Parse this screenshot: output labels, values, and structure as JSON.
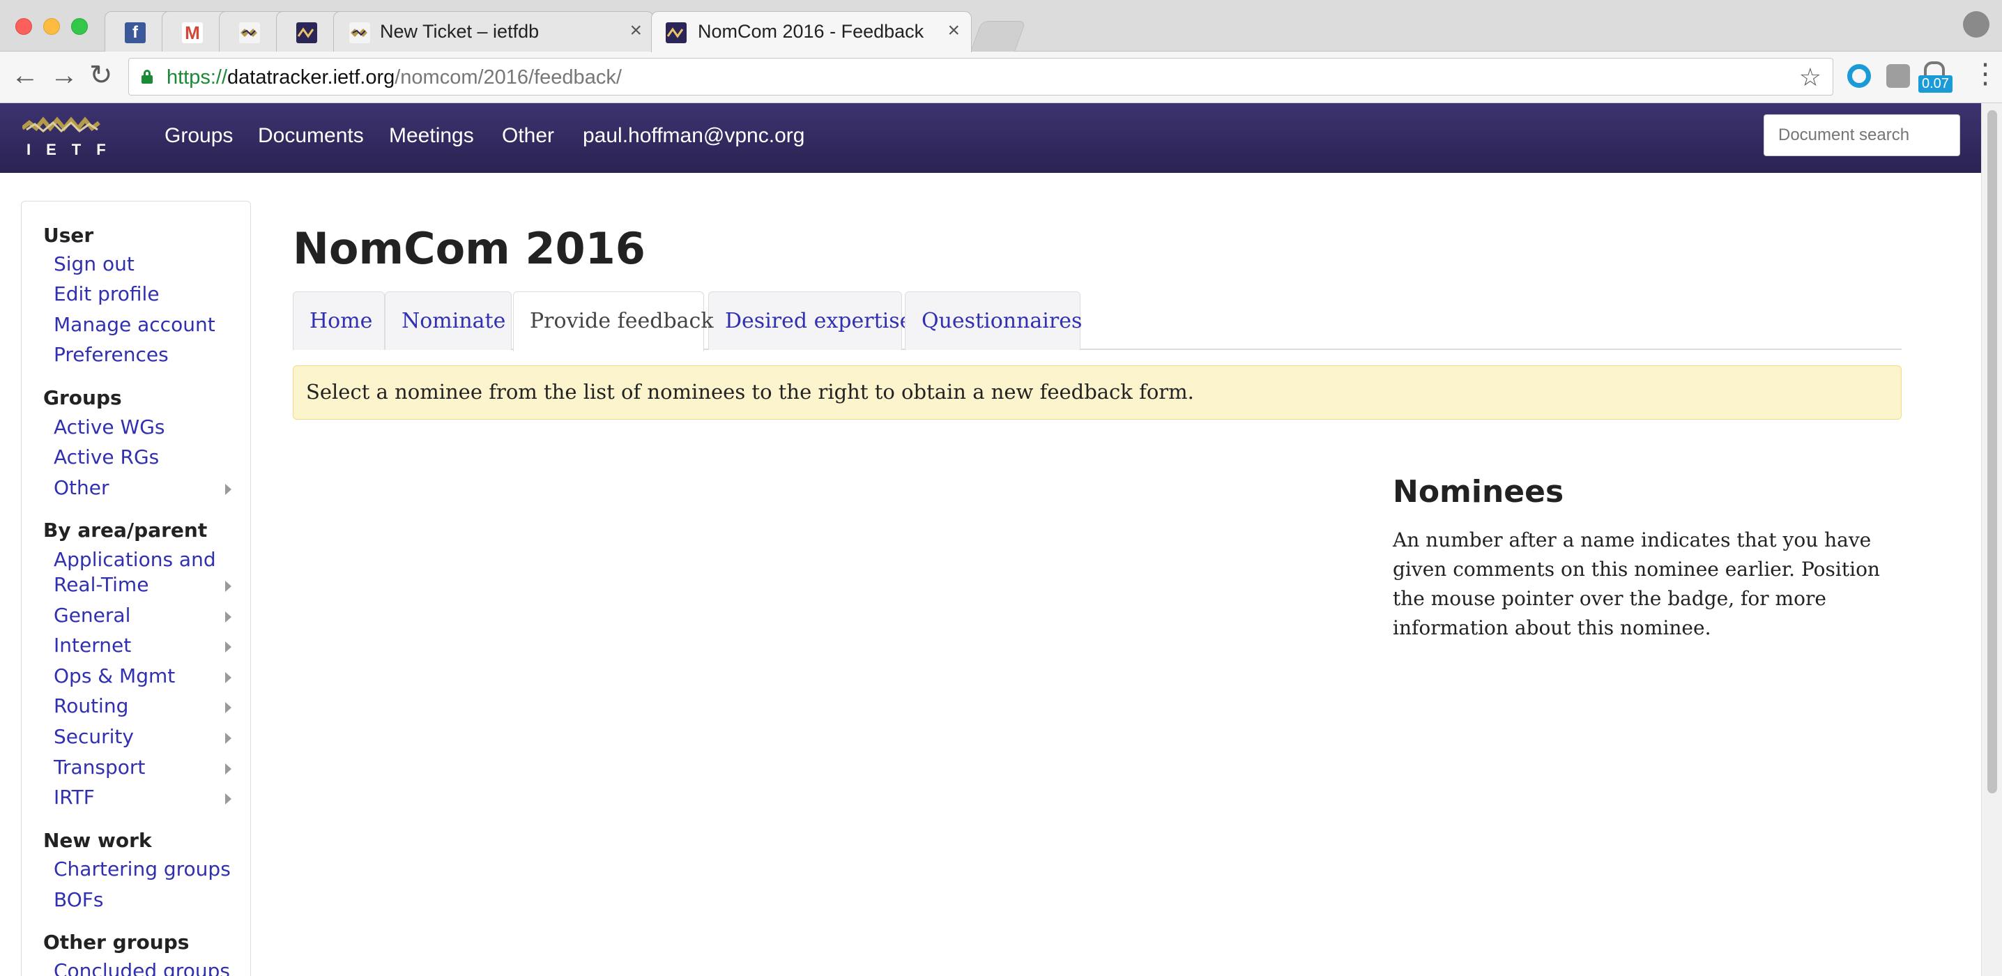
{
  "browser": {
    "tabs": [
      {
        "favicon": "facebook-icon",
        "title": ""
      },
      {
        "favicon": "gmail-icon",
        "title": ""
      },
      {
        "favicon": "ietf-icon",
        "title": ""
      },
      {
        "favicon": "datatracker-icon",
        "title": ""
      },
      {
        "favicon": "ietf-icon",
        "title": "New Ticket – ietfdb"
      },
      {
        "favicon": "datatracker-icon",
        "title": "NomCom 2016 - Feedback"
      }
    ],
    "close_glyph": "×",
    "url": {
      "scheme": "https://",
      "host": "datatracker.ietf.org",
      "path": "/nomcom/2016/feedback/"
    },
    "extension_badge": "0.07",
    "back_glyph": "←",
    "forward_glyph": "→",
    "reload_glyph": "↻",
    "star_glyph": "☆",
    "menu_glyph": "⋮"
  },
  "site": {
    "logo_text": "IETF",
    "nav": [
      "Groups",
      "Documents",
      "Meetings",
      "Other",
      "paul.hoffman@vpnc.org"
    ],
    "search_placeholder": "Document search"
  },
  "sidebar": {
    "sections": [
      {
        "heading": "User",
        "items": [
          {
            "label": "Sign out",
            "submenu": false
          },
          {
            "label": "Edit profile",
            "submenu": false
          },
          {
            "label": "Manage account",
            "submenu": false
          },
          {
            "label": "Preferences",
            "submenu": false
          }
        ]
      },
      {
        "heading": "Groups",
        "items": [
          {
            "label": "Active WGs",
            "submenu": false
          },
          {
            "label": "Active RGs",
            "submenu": false
          },
          {
            "label": "Other",
            "submenu": true
          }
        ]
      },
      {
        "heading": "By area/parent",
        "items": [
          {
            "label": "Applications and",
            "label2": "Real-Time",
            "submenu": true
          },
          {
            "label": "General",
            "submenu": true
          },
          {
            "label": "Internet",
            "submenu": true
          },
          {
            "label": "Ops & Mgmt",
            "submenu": true
          },
          {
            "label": "Routing",
            "submenu": true
          },
          {
            "label": "Security",
            "submenu": true
          },
          {
            "label": "Transport",
            "submenu": true
          },
          {
            "label": "IRTF",
            "submenu": true
          }
        ]
      },
      {
        "heading": "New work",
        "items": [
          {
            "label": "Chartering groups",
            "submenu": false
          },
          {
            "label": "BOFs",
            "submenu": false
          }
        ]
      },
      {
        "heading": "Other groups",
        "items": [
          {
            "label": "Concluded groups",
            "submenu": false
          }
        ]
      }
    ]
  },
  "main": {
    "title": "NomCom 2016",
    "tabs": [
      "Home",
      "Nominate",
      "Provide feedback",
      "Desired expertise",
      "Questionnaires"
    ],
    "active_tab": "Provide feedback",
    "alert": "Select a nominee from the list of nominees to the right to obtain a new feedback form.",
    "nominees_heading": "Nominees",
    "nominees_text": "An number after a name indicates that you have given comments on this nominee earlier. Position the mouse pointer over the badge, for more information about this nominee."
  },
  "colors": {
    "navbar": "#2a2352",
    "link": "#3030b0",
    "alert_bg": "#fcf4cc",
    "secure_green": "#1a8a34"
  }
}
